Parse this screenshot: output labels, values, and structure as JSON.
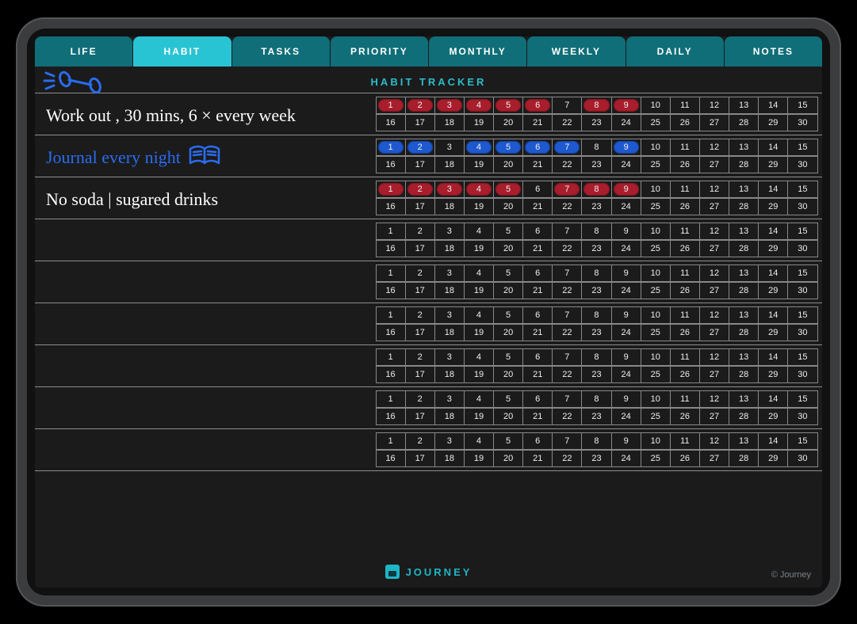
{
  "tabs": [
    {
      "label": "LIFE",
      "active": false
    },
    {
      "label": "HABIT",
      "active": true
    },
    {
      "label": "TASKS",
      "active": false
    },
    {
      "label": "PRIORITY",
      "active": false
    },
    {
      "label": "MONTHLY",
      "active": false
    },
    {
      "label": "WEEKLY",
      "active": false
    },
    {
      "label": "DAILY",
      "active": false
    },
    {
      "label": "NOTES",
      "active": false
    }
  ],
  "title": "HABIT TRACKER",
  "days_per_row": 30,
  "habits": [
    {
      "label": "Work out , 30 mins, 6 × every week",
      "ink": "white",
      "doodle": "dumbbell",
      "marks": {
        "1": "red",
        "2": "red",
        "3": "red",
        "4": "red",
        "5": "red",
        "6": "red",
        "8": "red",
        "9": "red"
      }
    },
    {
      "label": "Journal every night",
      "ink": "blue",
      "doodle": "book",
      "marks": {
        "1": "blue",
        "2": "blue",
        "4": "blue",
        "5": "blue",
        "6": "blue",
        "7": "blue",
        "9": "blue"
      }
    },
    {
      "label": "No soda | sugared drinks",
      "ink": "white",
      "marks": {
        "1": "red",
        "2": "red",
        "3": "red",
        "4": "red",
        "5": "red",
        "7": "red",
        "8": "red",
        "9": "red"
      }
    },
    {
      "label": "",
      "ink": "white",
      "marks": {}
    },
    {
      "label": "",
      "ink": "white",
      "marks": {}
    },
    {
      "label": "",
      "ink": "white",
      "marks": {}
    },
    {
      "label": "",
      "ink": "white",
      "marks": {}
    },
    {
      "label": "",
      "ink": "white",
      "marks": {}
    },
    {
      "label": "",
      "ink": "white",
      "marks": {}
    }
  ],
  "footer": {
    "brand": "JOURNEY",
    "copyright": "© Journey"
  }
}
